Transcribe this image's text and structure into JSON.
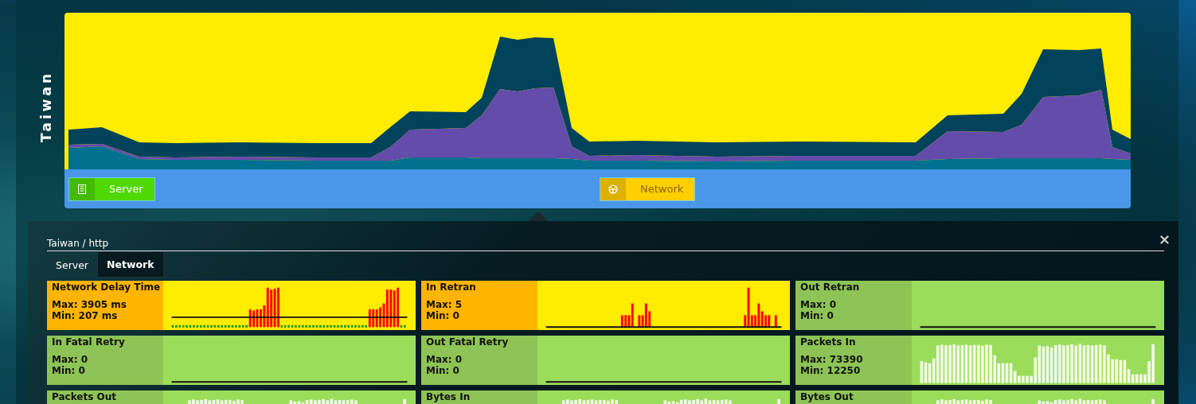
{
  "region": {
    "label": "Taiwan"
  },
  "layer_buttons": [
    {
      "label": "Server",
      "color": "#4fd806",
      "disabled": false
    },
    {
      "label": "Network",
      "color": "#ffcf00",
      "disabled": true
    }
  ],
  "detail": {
    "breadcrumb": "Taiwan / http",
    "tabs": [
      {
        "label": "Server",
        "selected": false
      },
      {
        "label": "Network",
        "selected": true
      }
    ],
    "tiles": [
      {
        "title": "Network Delay Time",
        "max": "Max: 3905 ms",
        "min": "Min: 207 ms",
        "color": "#ffec00",
        "kind": "delay"
      },
      {
        "title": "In Retran",
        "max": "Max: 5",
        "min": "Min: 0",
        "color": "#ffec00",
        "kind": "spikes"
      },
      {
        "title": "Out Retran",
        "max": "Max: 0",
        "min": "Min: 0",
        "color": "#9bdd5b",
        "kind": "flat"
      },
      {
        "title": "In Fatal Retry",
        "max": "Max: 0",
        "min": "Min: 0",
        "color": "#9bdd5b",
        "kind": "flat"
      },
      {
        "title": "Out Fatal Retry",
        "max": "Max: 0",
        "min": "Min: 0",
        "color": "#9bdd5b",
        "kind": "flat"
      },
      {
        "title": "Packets In",
        "max": "Max: 73390",
        "min": "Min: 12250",
        "color": "#9bdd5b",
        "kind": "bars"
      },
      {
        "title": "Packets Out",
        "color": "#9bdd5b",
        "kind": "bars"
      },
      {
        "title": "Bytes In",
        "color": "#9bdd5b",
        "kind": "bars"
      },
      {
        "title": "Bytes Out",
        "color": "#9bdd5b",
        "kind": "bars"
      }
    ]
  }
}
